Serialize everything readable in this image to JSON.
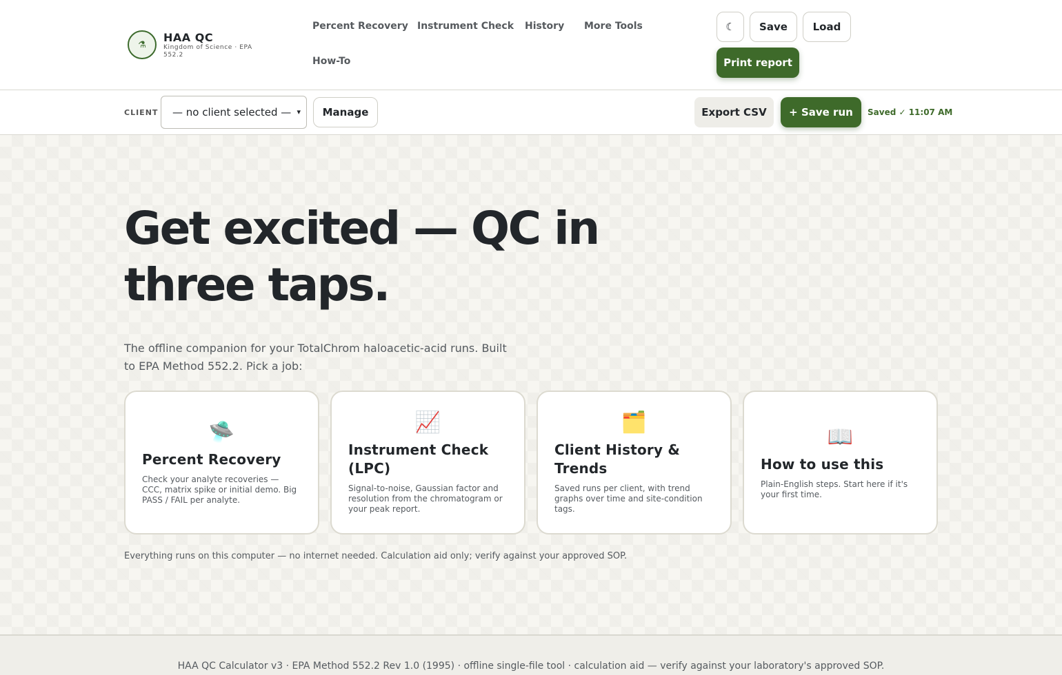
{
  "brand": {
    "title": "HAA QC",
    "subtitle": "Kingdom of Science · EPA 552.2",
    "logo_icon": "flask-icon"
  },
  "nav": {
    "items": [
      {
        "label": "Percent Recovery"
      },
      {
        "label": "Instrument Check"
      },
      {
        "label": "History"
      },
      {
        "label": "More Tools"
      },
      {
        "label": "How-To"
      }
    ]
  },
  "header_actions": {
    "theme_toggle_icon": "moon-icon",
    "save_label": "Save",
    "load_label": "Load",
    "print_label": "Print report"
  },
  "client_bar": {
    "label": "CLIENT",
    "selected": "— no client selected —",
    "manage_label": "Manage",
    "export_label": "Export CSV",
    "save_run_label": "+ Save run",
    "saved_status": "Saved ✓ 11:07 AM"
  },
  "hero": {
    "title": "Get excited — QC in three taps.",
    "subtitle": "The offline companion for your TotalChrom haloacetic-acid runs. Built to EPA Method 552.2. Pick a job:",
    "note": "Everything runs on this computer — no internet needed. Calculation aid only; verify against your approved SOP."
  },
  "cards": [
    {
      "icon": "🛸",
      "icon_name": "ufo-icon",
      "title": "Percent Recovery",
      "desc": "Check your analyte recoveries — CCC, matrix spike or initial demo. Big PASS / FAIL per analyte."
    },
    {
      "icon": "📈",
      "icon_name": "chart-icon",
      "title": "Instrument Check (LPC)",
      "desc": "Signal-to-noise, Gaussian factor and resolution from the chromatogram or your peak report."
    },
    {
      "icon": "🗂️",
      "icon_name": "folder-icon",
      "title": "Client History & Trends",
      "desc": "Saved runs per client, with trend graphs over time and site-condition tags."
    },
    {
      "icon": "📖",
      "icon_name": "book-icon",
      "title": "How to use this",
      "desc": "Plain-English steps. Start here if it's your first time."
    }
  ],
  "footer": {
    "text": "HAA QC Calculator v3 · EPA Method 552.2 Rev 1.0 (1995) · offline single-file tool · calculation aid — verify against your laboratory's approved SOP."
  },
  "colors": {
    "accent": "#3e6a2a",
    "background": "#f7f6f1",
    "text": "#22262a"
  }
}
